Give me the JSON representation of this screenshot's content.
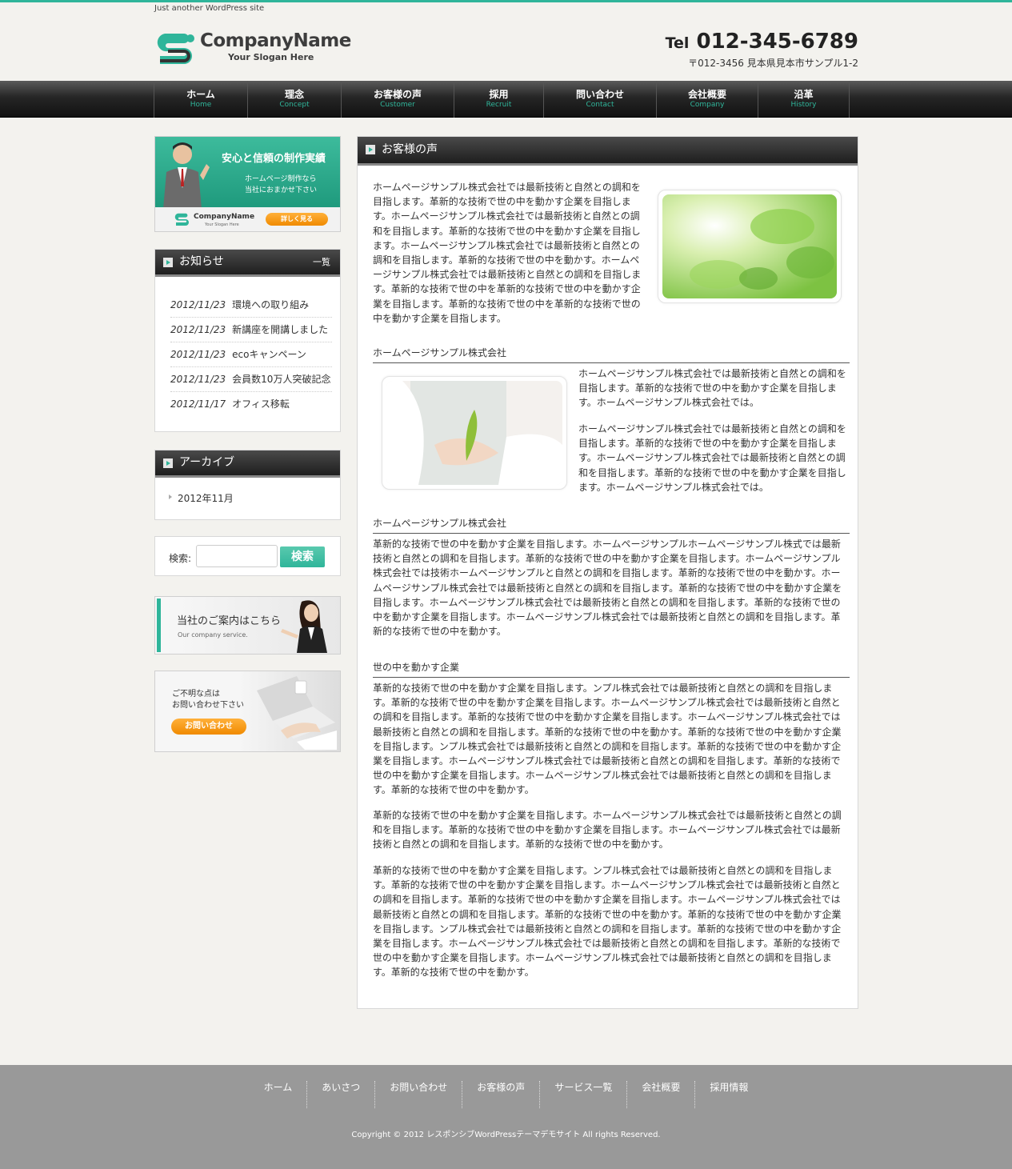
{
  "header": {
    "tagline": "Just another WordPress site",
    "company_name": "CompanyName",
    "slogan": "Your Slogan Here",
    "tel_label": "Tel",
    "tel_number": "012-345-6789",
    "address": "〒012-3456 見本県見本市サンプル1-2"
  },
  "nav": [
    {
      "jp": "ホーム",
      "en": "Home"
    },
    {
      "jp": "理念",
      "en": "Concept"
    },
    {
      "jp": "お客様の声",
      "en": "Customer"
    },
    {
      "jp": "採用",
      "en": "Recruit"
    },
    {
      "jp": "問い合わせ",
      "en": "Contact"
    },
    {
      "jp": "会社概要",
      "en": "Company"
    },
    {
      "jp": "沿革",
      "en": "History"
    }
  ],
  "sidebar": {
    "banner1": {
      "heading": "安心と信頼の制作実績",
      "sub1": "ホームページ制作なら",
      "sub2": "当社におまかせ下さい",
      "company": "CompanyName",
      "slogan": "Your Slogan Here",
      "button": "詳しく見る"
    },
    "news": {
      "title": "お知らせ",
      "more": "一覧",
      "items": [
        {
          "date": "2012/11/23",
          "text": "環境への取り組み"
        },
        {
          "date": "2012/11/23",
          "text": "新講座を開講しました"
        },
        {
          "date": "2012/11/23",
          "text": "ecoキャンペーン"
        },
        {
          "date": "2012/11/23",
          "text": "会員数10万人突破記念"
        },
        {
          "date": "2012/11/17",
          "text": "オフィス移転"
        }
      ]
    },
    "archive": {
      "title": "アーカイブ",
      "items": [
        "2012年11月"
      ]
    },
    "search": {
      "label": "検索:",
      "button": "検索",
      "value": ""
    },
    "banner2": {
      "title": "当社のご案内はこちら",
      "sub": "Our company service."
    },
    "banner3": {
      "line1": "ご不明な点は",
      "line2": "お問い合わせ下さい",
      "button": "お問い合わせ"
    }
  },
  "main": {
    "title": "お客様の声",
    "p1": "ホームページサンプル株式会社では最新技術と自然との調和を目指します。革新的な技術で世の中を動かす企業を目指します。ホームページサンプル株式会社では最新技術と自然との調和を目指します。革新的な技術で世の中を動かす企業を目指します。ホームページサンプル株式会社では最新技術と自然との調和を目指します。革新的な技術で世の中を動かす。ホームページサンプル株式会社では最新技術と自然との調和を目指します。革新的な技術で世の中を革新的な技術で世の中を動かす企業を目指します。革新的な技術で世の中を革新的な技術で世の中を動かす企業を目指します。",
    "sub1": "ホームページサンプル株式会社",
    "p2": "ホームページサンプル株式会社では最新技術と自然との調和を目指します。革新的な技術で世の中を動かす企業を目指します。ホームページサンプル株式会社では。",
    "p3": "ホームページサンプル株式会社では最新技術と自然との調和を目指します。革新的な技術で世の中を動かす企業を目指します。ホームページサンプル株式会社では最新技術と自然との調和を目指します。革新的な技術で世の中を動かす企業を目指します。ホームページサンプル株式会社では。",
    "sub2": "ホームページサンプル株式会社",
    "p4": "革新的な技術で世の中を動かす企業を目指します。ホームページサンプルホームページサンプル株式では最新技術と自然との調和を目指します。革新的な技術で世の中を動かす企業を目指します。ホームページサンプル株式会社では技術ホームページサンプルと自然との調和を目指します。革新的な技術で世の中を動かす。ホームページサンプル株式会社では最新技術と自然との調和を目指します。革新的な技術で世の中を動かす企業を目指します。ホームページサンプル株式会社では最新技術と自然との調和を目指します。革新的な技術で世の中を動かす企業を目指します。ホームページサンプル株式会社では最新技術と自然との調和を目指します。革新的な技術で世の中を動かす。",
    "sub3": "世の中を動かす企業",
    "p5": "革新的な技術で世の中を動かす企業を目指します。ンプル株式会社では最新技術と自然との調和を目指します。革新的な技術で世の中を動かす企業を目指します。ホームページサンプル株式会社では最新技術と自然との調和を目指します。革新的な技術で世の中を動かす企業を目指します。ホームページサンプル株式会社では最新技術と自然との調和を目指します。革新的な技術で世の中を動かす。革新的な技術で世の中を動かす企業を目指します。ンプル株式会社では最新技術と自然との調和を目指します。革新的な技術で世の中を動かす企業を目指します。ホームページサンプル株式会社では最新技術と自然との調和を目指します。革新的な技術で世の中を動かす企業を目指します。ホームページサンプル株式会社では最新技術と自然との調和を目指します。革新的な技術で世の中を動かす。",
    "p6": "革新的な技術で世の中を動かす企業を目指します。ホームページサンプル株式会社では最新技術と自然との調和を目指します。革新的な技術で世の中を動かす企業を目指します。ホームページサンプル株式会社では最新技術と自然との調和を目指します。革新的な技術で世の中を動かす。",
    "p7": "革新的な技術で世の中を動かす企業を目指します。ンプル株式会社では最新技術と自然との調和を目指します。革新的な技術で世の中を動かす企業を目指します。ホームページサンプル株式会社では最新技術と自然との調和を目指します。革新的な技術で世の中を動かす企業を目指します。ホームページサンプル株式会社では最新技術と自然との調和を目指します。革新的な技術で世の中を動かす。革新的な技術で世の中を動かす企業を目指します。ンプル株式会社では最新技術と自然との調和を目指します。革新的な技術で世の中を動かす企業を目指します。ホームページサンプル株式会社では最新技術と自然との調和を目指します。革新的な技術で世の中を動かす企業を目指します。ホームページサンプル株式会社では最新技術と自然との調和を目指します。革新的な技術で世の中を動かす。"
  },
  "footer": {
    "links": [
      "ホーム",
      "あいさつ",
      "お問い合わせ",
      "お客様の声",
      "サービス一覧",
      "会社概要",
      "採用情報"
    ],
    "copyright": "Copyright © 2012 レスポンシブWordPressテーマデモサイト All rights Reserved."
  },
  "colors": {
    "accent": "#2fb59a",
    "nav_bg": "#1e1e1e",
    "footer_bg": "#999999",
    "page_bg": "#f3f2ee"
  }
}
